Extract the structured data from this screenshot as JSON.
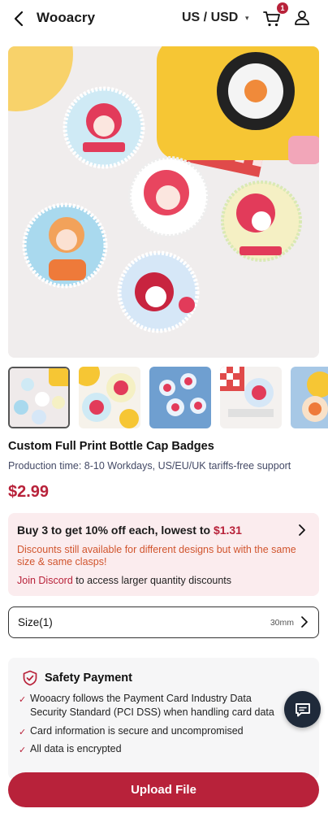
{
  "header": {
    "brand": "Wooacry",
    "region": "US / USD",
    "cart_count": "1"
  },
  "colors": {
    "accent": "#b8223a",
    "promo_bg": "#fbecee",
    "note_orange": "#d1552e",
    "fab": "#1f2a3a"
  },
  "icons": [
    "back-arrow-icon",
    "chevron-down-icon",
    "cart-icon",
    "user-icon",
    "chevron-right-icon",
    "shield-check-icon",
    "check-icon",
    "chat-icon"
  ],
  "gallery": {
    "thumb_count": 5,
    "active_index": 0
  },
  "product": {
    "title": "Custom Full Print Bottle Cap Badges",
    "subtitle": "Production time: 8-10 Workdays, US/EU/UK tariffs-free support",
    "price": "$2.99"
  },
  "promo": {
    "main_prefix": "Buy 3 to get 10% off each, lowest to ",
    "main_price": "$1.31",
    "note": "Discounts still available for different designs but with the same size & same clasps!",
    "discord_link": "Join Discord",
    "discord_rest": " to access larger quantity discounts"
  },
  "size": {
    "label": "Size(1)",
    "value": "30mm"
  },
  "safety": {
    "title": "Safety Payment",
    "items": [
      "Wooacry follows the Payment Card Industry Data Security Standard (PCI DSS) when handling card data",
      "Card information is secure and uncompromised",
      "All data is encrypted"
    ]
  },
  "cta": {
    "upload": "Upload File"
  }
}
